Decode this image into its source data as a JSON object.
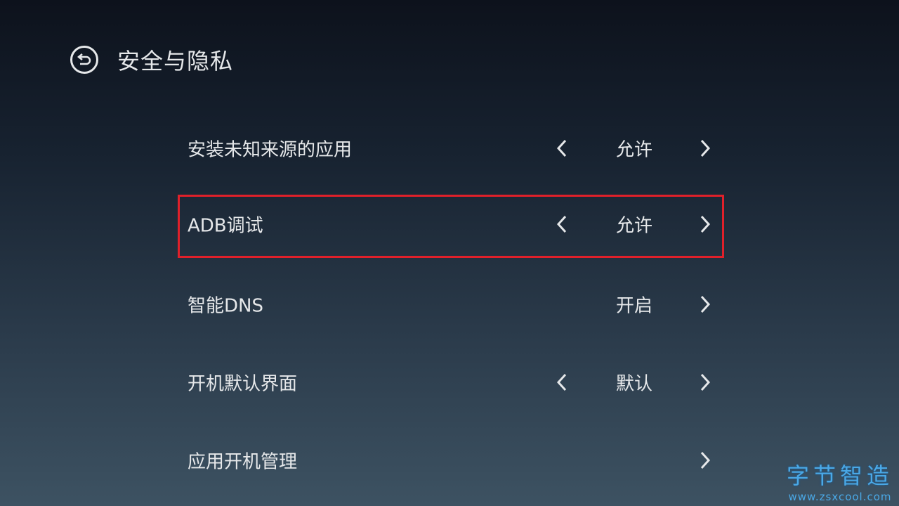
{
  "header": {
    "title": "安全与隐私",
    "back_icon": "back-icon"
  },
  "rows": [
    {
      "label": "安装未知来源的应用",
      "value": "允许",
      "has_left": true,
      "selected": false
    },
    {
      "label": "ADB调试",
      "value": "允许",
      "has_left": true,
      "selected": true
    },
    {
      "label": "智能DNS",
      "value": "开启",
      "has_left": false,
      "selected": false
    },
    {
      "label": "开机默认界面",
      "value": "默认",
      "has_left": true,
      "selected": false
    },
    {
      "label": "应用开机管理",
      "value": "",
      "has_left": false,
      "selected": false
    }
  ],
  "watermark": {
    "logo": "字节智造",
    "url": "www.zsxcool.com"
  },
  "colors": {
    "selection": "#e0202a",
    "text": "#e6e8ea"
  }
}
